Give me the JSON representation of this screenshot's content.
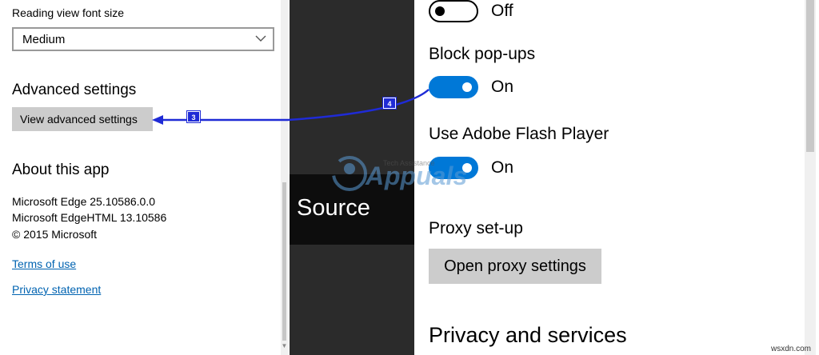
{
  "left": {
    "font_size_label": "Reading view font size",
    "font_size_value": "Medium",
    "advanced_heading": "Advanced settings",
    "advanced_button": "View advanced settings",
    "about_heading": "About this app",
    "about_lines": [
      "Microsoft Edge 25.10586.0.0",
      "Microsoft EdgeHTML 13.10586",
      "© 2015 Microsoft"
    ],
    "terms_link": "Terms of use",
    "privacy_link": "Privacy statement"
  },
  "middle": {
    "source_text": "Source"
  },
  "right": {
    "top_toggle_state": "Off",
    "block_popups_heading": "Block pop-ups",
    "block_popups_state": "On",
    "flash_heading": "Use Adobe Flash Player",
    "flash_state": "On",
    "proxy_heading": "Proxy set-up",
    "proxy_button": "Open proxy settings",
    "privacy_heading": "Privacy and services"
  },
  "annotations": {
    "badge_3": "3",
    "badge_4": "4",
    "watermark_title": "Appuals",
    "watermark_sub": "Tech Assistance",
    "corner_watermark": "wsxdn.com"
  },
  "colors": {
    "toggle_on": "#0078d7",
    "link": "#0063b1",
    "annotation": "#1f2bd6",
    "dark_panel": "#2b2b2b"
  }
}
